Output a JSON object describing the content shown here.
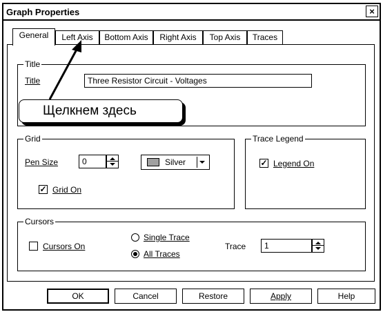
{
  "window": {
    "title": "Graph Properties",
    "close_glyph": "×"
  },
  "tabs": [
    {
      "label": "General",
      "active": true
    },
    {
      "label": "Left Axis"
    },
    {
      "label": "Bottom Axis"
    },
    {
      "label": "Right Axis"
    },
    {
      "label": "Top Axis"
    },
    {
      "label": "Traces"
    }
  ],
  "title_group": {
    "label": "Title",
    "field_label": "Title",
    "value": "Three Resistor Circuit - Voltages"
  },
  "annotation": {
    "text": "Щелкнем здесь"
  },
  "grid_group": {
    "label": "Grid",
    "pen_size_label": "Pen Size",
    "pen_size_value": "0",
    "color_value": "Silver",
    "color_hex": "#a0a0a0",
    "grid_on_label": "Grid On",
    "grid_on_checked": true
  },
  "legend_group": {
    "label": "Trace Legend",
    "legend_on_label": "Legend On",
    "legend_on_checked": true
  },
  "cursors_group": {
    "label": "Cursors",
    "cursors_on_label": "Cursors On",
    "cursors_on_checked": false,
    "single_trace_label": "Single Trace",
    "all_traces_label": "All Traces",
    "selected": "All Traces",
    "trace_label": "Trace",
    "trace_value": "1"
  },
  "buttons": {
    "ok": "OK",
    "cancel": "Cancel",
    "restore": "Restore",
    "apply": "Apply",
    "help": "Help"
  },
  "check_glyph": "✓"
}
